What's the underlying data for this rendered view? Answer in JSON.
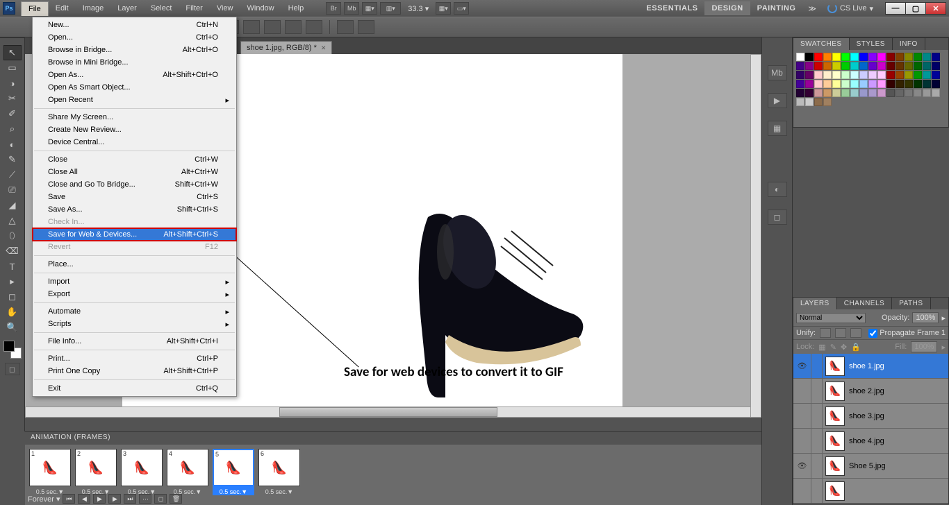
{
  "menubar": [
    "File",
    "Edit",
    "Image",
    "Layer",
    "Select",
    "Filter",
    "View",
    "Window",
    "Help"
  ],
  "menubar_open": "File",
  "zoom": "33.3",
  "workspaces": [
    {
      "label": "ESSENTIALS",
      "active": false
    },
    {
      "label": "DESIGN",
      "active": true
    },
    {
      "label": "PAINTING",
      "active": false
    }
  ],
  "cslive": "CS Live",
  "doc_tab": "shoe 1.jpg, RGB/8) *",
  "file_menu": [
    {
      "label": "New...",
      "sc": "Ctrl+N"
    },
    {
      "label": "Open...",
      "sc": "Ctrl+O"
    },
    {
      "label": "Browse in Bridge...",
      "sc": "Alt+Ctrl+O"
    },
    {
      "label": "Browse in Mini Bridge..."
    },
    {
      "label": "Open As...",
      "sc": "Alt+Shift+Ctrl+O"
    },
    {
      "label": "Open As Smart Object..."
    },
    {
      "label": "Open Recent",
      "sub": true
    },
    {
      "sep": true
    },
    {
      "label": "Share My Screen..."
    },
    {
      "label": "Create New Review..."
    },
    {
      "label": "Device Central..."
    },
    {
      "sep": true
    },
    {
      "label": "Close",
      "sc": "Ctrl+W"
    },
    {
      "label": "Close All",
      "sc": "Alt+Ctrl+W"
    },
    {
      "label": "Close and Go To Bridge...",
      "sc": "Shift+Ctrl+W"
    },
    {
      "label": "Save",
      "sc": "Ctrl+S"
    },
    {
      "label": "Save As...",
      "sc": "Shift+Ctrl+S"
    },
    {
      "label": "Check In...",
      "disabled": true
    },
    {
      "label": "Save for Web & Devices...",
      "sc": "Alt+Shift+Ctrl+S",
      "hl": true
    },
    {
      "label": "Revert",
      "sc": "F12",
      "disabled": true
    },
    {
      "sep": true
    },
    {
      "label": "Place..."
    },
    {
      "sep": true
    },
    {
      "label": "Import",
      "sub": true
    },
    {
      "label": "Export",
      "sub": true
    },
    {
      "sep": true
    },
    {
      "label": "Automate",
      "sub": true
    },
    {
      "label": "Scripts",
      "sub": true
    },
    {
      "sep": true
    },
    {
      "label": "File Info...",
      "sc": "Alt+Shift+Ctrl+I"
    },
    {
      "sep": true
    },
    {
      "label": "Print...",
      "sc": "Ctrl+P"
    },
    {
      "label": "Print One Copy",
      "sc": "Alt+Shift+Ctrl+P"
    },
    {
      "sep": true
    },
    {
      "label": "Exit",
      "sc": "Ctrl+Q"
    }
  ],
  "annotation": "Save for web devices to convert it to GIF",
  "panels": {
    "swatches_tabs": [
      "SWATCHES",
      "STYLES",
      "INFO"
    ],
    "layers_tabs": [
      "LAYERS",
      "CHANNELS",
      "PATHS"
    ],
    "blend": "Normal",
    "opacity_label": "Opacity:",
    "opacity": "100%",
    "unify_label": "Unify:",
    "propagate": "Propagate Frame 1",
    "lock_label": "Lock:",
    "fill_label": "Fill:",
    "fill": "100%"
  },
  "layers": [
    {
      "name": "shoe 1.jpg",
      "active": true,
      "vis": true
    },
    {
      "name": "shoe 2.jpg"
    },
    {
      "name": "shoe 3.jpg"
    },
    {
      "name": "shoe 4.jpg"
    },
    {
      "name": "Shoe 5.jpg",
      "vis": true
    },
    {
      "name": ""
    }
  ],
  "animation": {
    "title": "ANIMATION (FRAMES)",
    "frames": [
      {
        "n": "1",
        "dur": "0.5 sec.▼"
      },
      {
        "n": "2",
        "dur": "0.5 sec.▼"
      },
      {
        "n": "3",
        "dur": "0.5 sec.▼"
      },
      {
        "n": "4",
        "dur": "0.5 sec.▼"
      },
      {
        "n": "5",
        "dur": "0.5 sec.▼",
        "sel": true
      },
      {
        "n": "6",
        "dur": "0.5 sec.▼"
      }
    ],
    "loop": "Forever"
  },
  "swatch_colors": [
    "#fff",
    "#000",
    "#f00",
    "#ff8000",
    "#ff0",
    "#0f0",
    "#0ff",
    "#00f",
    "#80f",
    "#f0f",
    "#800",
    "#804000",
    "#880",
    "#080",
    "#088",
    "#008",
    "#408",
    "#808",
    "#c00",
    "#c60",
    "#cc0",
    "#0c0",
    "#0cc",
    "#06c",
    "#60c",
    "#c0c",
    "#600",
    "#630",
    "#660",
    "#060",
    "#066",
    "#006",
    "#306",
    "#606",
    "#fcc",
    "#fec",
    "#ffc",
    "#cfc",
    "#cff",
    "#ccf",
    "#ecf",
    "#fcf",
    "#900",
    "#940",
    "#990",
    "#090",
    "#099",
    "#009",
    "#409",
    "#909",
    "#fcc",
    "#fc9",
    "#ff9",
    "#cfc",
    "#9ff",
    "#9cf",
    "#c9f",
    "#f9f",
    "#300",
    "#320",
    "#330",
    "#030",
    "#033",
    "#003",
    "#203",
    "#303",
    "#c99",
    "#c96",
    "#cc9",
    "#9c9",
    "#9cc",
    "#99c",
    "#a9c",
    "#c9c",
    "#555",
    "#666",
    "#777",
    "#888",
    "#999",
    "#aaa",
    "#bbb",
    "#ccc",
    "#8b6b4b",
    "#a08060"
  ],
  "tools": [
    "↖",
    "▭",
    "◑",
    "✂",
    "✐",
    "⌕",
    "◐",
    "✎",
    "⟋",
    "⎚",
    "◢",
    "△",
    "⬯",
    "⌫",
    "T",
    "▸",
    "◻",
    "✋",
    "🔍"
  ]
}
